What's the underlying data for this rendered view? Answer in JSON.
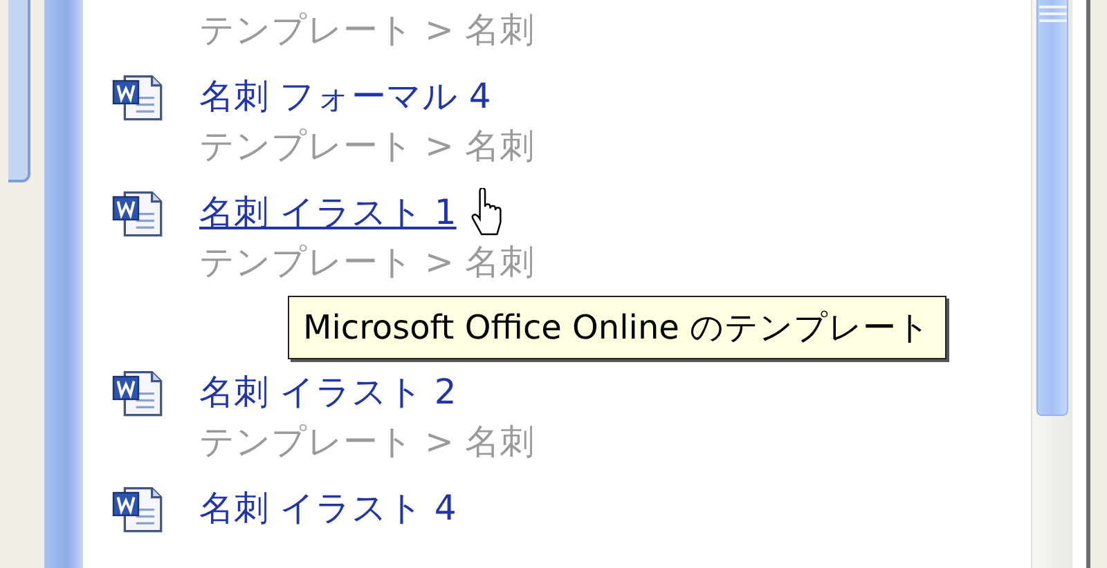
{
  "results": [
    {
      "subtitle": "テンプレート > 名刺"
    },
    {
      "title": "名刺 フォーマル 4",
      "subtitle": "テンプレート > 名刺",
      "hovered": false
    },
    {
      "title": "名刺 イラスト 1",
      "subtitle": "テンプレート > 名刺",
      "hovered": true
    },
    {
      "title": "名刺 イラスト 2",
      "subtitle": "テンプレート > 名刺",
      "hovered": false
    },
    {
      "title": "名刺 イラスト 4",
      "hovered": false
    }
  ],
  "tooltip": "Microsoft Office Online のテンプレート"
}
